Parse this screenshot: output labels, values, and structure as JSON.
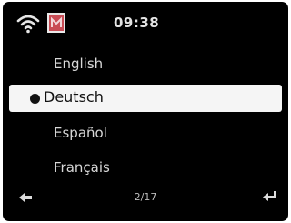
{
  "status_bar": {
    "time": "09:38",
    "wifi_icon": "wifi-icon",
    "source_icon": "media-source-icon"
  },
  "menu": {
    "items": [
      {
        "label": "English",
        "selected": false
      },
      {
        "label": "Deutsch",
        "selected": true
      },
      {
        "label": "Español",
        "selected": false
      },
      {
        "label": "Français",
        "selected": false
      }
    ]
  },
  "footer": {
    "back_icon": "back-arrow-icon",
    "page_indicator": "2/17",
    "enter_icon": "enter-return-icon"
  },
  "colors": {
    "background": "#000000",
    "highlight": "#f5f5f5",
    "source_icon": "#c94c55"
  }
}
